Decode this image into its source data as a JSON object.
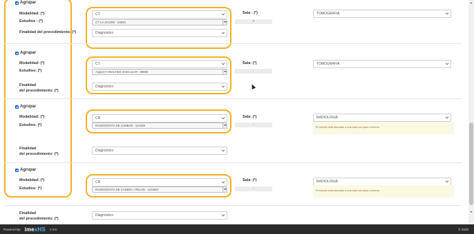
{
  "groups": [
    {
      "agrupar": "Agrupar",
      "modalidad_label": "Modalidad: (*)",
      "modalidad_value": "CT",
      "estudios_label": "Estudios : (*)",
      "estudios_value": "CT CA SCORE - 53538",
      "finalidad_label": "Finalidad del procedimiento: (*)",
      "finalidad_value": "Diagnóstico",
      "sala_label": "Sala : (*)",
      "sala_value": "+",
      "sala_select": "TOMOGRAFIA"
    },
    {
      "agrupar": "Agrupar",
      "modalidad_label": "Modalidad: (*)",
      "modalidad_value": "CT",
      "estudios_label": "Estudios: (*)",
      "estudios_value": "AngioCT ANALYSIS VASCULAR - 36986",
      "finalidad_label_1": "Finalidad",
      "finalidad_label_2": "del procedimiento: (*)",
      "finalidad_value": "Diagnóstico",
      "sala_label": "Sala: (*)",
      "sala_value": "-",
      "sala_select": "TOMOGRAFIA"
    },
    {
      "agrupar": "Agrupar",
      "modalidad_label": "Modalidad: (*)",
      "modalidad_value": "CR",
      "estudios_label": "Estudios: (*)",
      "estudios_value": "RADIOGRAFIA DE LUMBAR - 121456",
      "finalidad_label_1": "Finalidad",
      "finalidad_label_2": "del procedimiento: (*)",
      "finalidad_value": "Diagnóstico",
      "sala_label": "Sala: (*)",
      "sala_value": "-",
      "sala_select": "RADIOLOGIA",
      "warning": "El estudio está asociado a una sala con paso a lectura."
    },
    {
      "agrupar": "Agrupar",
      "modalidad_label": "Modalidad: (*)",
      "modalidad_value": "CR",
      "estudios_label": "Estudios: (*)",
      "estudios_value": "RADIOGRAFIA DE CADERA / PELVIS - 1234567",
      "finalidad_label_1": "Finalidad",
      "finalidad_label_2": "del procedimiento: (*)",
      "finalidad_value": "Diagnóstico",
      "sala_label": "Sala: (*)",
      "sala_value": "-",
      "sala_select": "RADIOLOGIA",
      "warning": "El estudio está asociado a una sala con paso a lectura."
    }
  ],
  "footer": {
    "powered": "Powered By:",
    "logo_a": "ime",
    "logo_b": "xHS",
    "version": "v 3.6",
    "copyright": "© 2020"
  },
  "colors": {
    "highlight": "#f2b01e",
    "checkbox": "#1a73e8",
    "warning_bg": "#fcf8e3",
    "footer_bg": "#2b2b2b"
  }
}
